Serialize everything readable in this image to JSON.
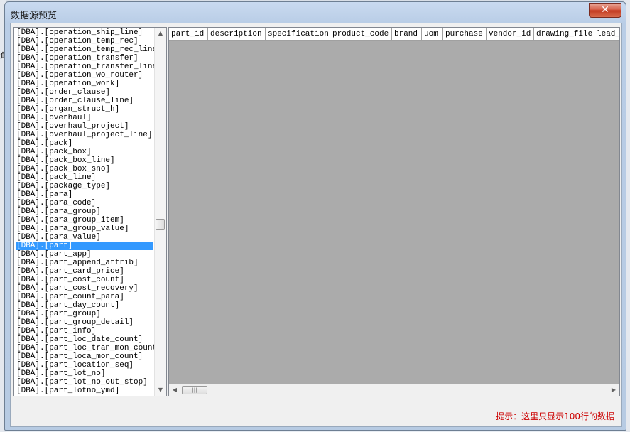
{
  "window": {
    "title": "数据源预览",
    "close_symbol": "✕"
  },
  "background": {
    "side_text": "角"
  },
  "table_list": {
    "items": [
      "[DBA].[operation_ship_line]",
      "[DBA].[operation_temp_rec]",
      "[DBA].[operation_temp_rec_line]",
      "[DBA].[operation_transfer]",
      "[DBA].[operation_transfer_line]",
      "[DBA].[operation_wo_router]",
      "[DBA].[operation_work]",
      "[DBA].[order_clause]",
      "[DBA].[order_clause_line]",
      "[DBA].[organ_struct_h]",
      "[DBA].[overhaul]",
      "[DBA].[overhaul_project]",
      "[DBA].[overhaul_project_line]",
      "[DBA].[pack]",
      "[DBA].[pack_box]",
      "[DBA].[pack_box_line]",
      "[DBA].[pack_box_sno]",
      "[DBA].[pack_line]",
      "[DBA].[package_type]",
      "[DBA].[para]",
      "[DBA].[para_code]",
      "[DBA].[para_group]",
      "[DBA].[para_group_item]",
      "[DBA].[para_group_value]",
      "[DBA].[para_value]",
      "[DBA].[part]",
      "[DBA].[part_app]",
      "[DBA].[part_append_attrib]",
      "[DBA].[part_card_price]",
      "[DBA].[part_cost_count]",
      "[DBA].[part_cost_recovery]",
      "[DBA].[part_count_para]",
      "[DBA].[part_day_count]",
      "[DBA].[part_group]",
      "[DBA].[part_group_detail]",
      "[DBA].[part_info]",
      "[DBA].[part_loc_date_count]",
      "[DBA].[part_loc_tran_mon_count]",
      "[DBA].[part_loca_mon_count]",
      "[DBA].[part_location_seq]",
      "[DBA].[part_lot_no]",
      "[DBA].[part_lot_no_out_stop]",
      "[DBA].[part_lotno_ymd]"
    ],
    "selected_index": 25
  },
  "data_grid": {
    "columns": [
      "part_id",
      "description",
      "specification",
      "product_code",
      "brand",
      "uom",
      "purchase",
      "vendor_id",
      "drawing_file",
      "lead_t"
    ]
  },
  "scrollbar": {
    "up": "▲",
    "down": "▼",
    "left": "◀",
    "right": "▶",
    "grip": "|||"
  },
  "hint": "提示：这里只显示100行的数据",
  "colors": {
    "selection": "#3399ff",
    "hint_text": "#cc0000",
    "grid_background": "#ababab"
  }
}
